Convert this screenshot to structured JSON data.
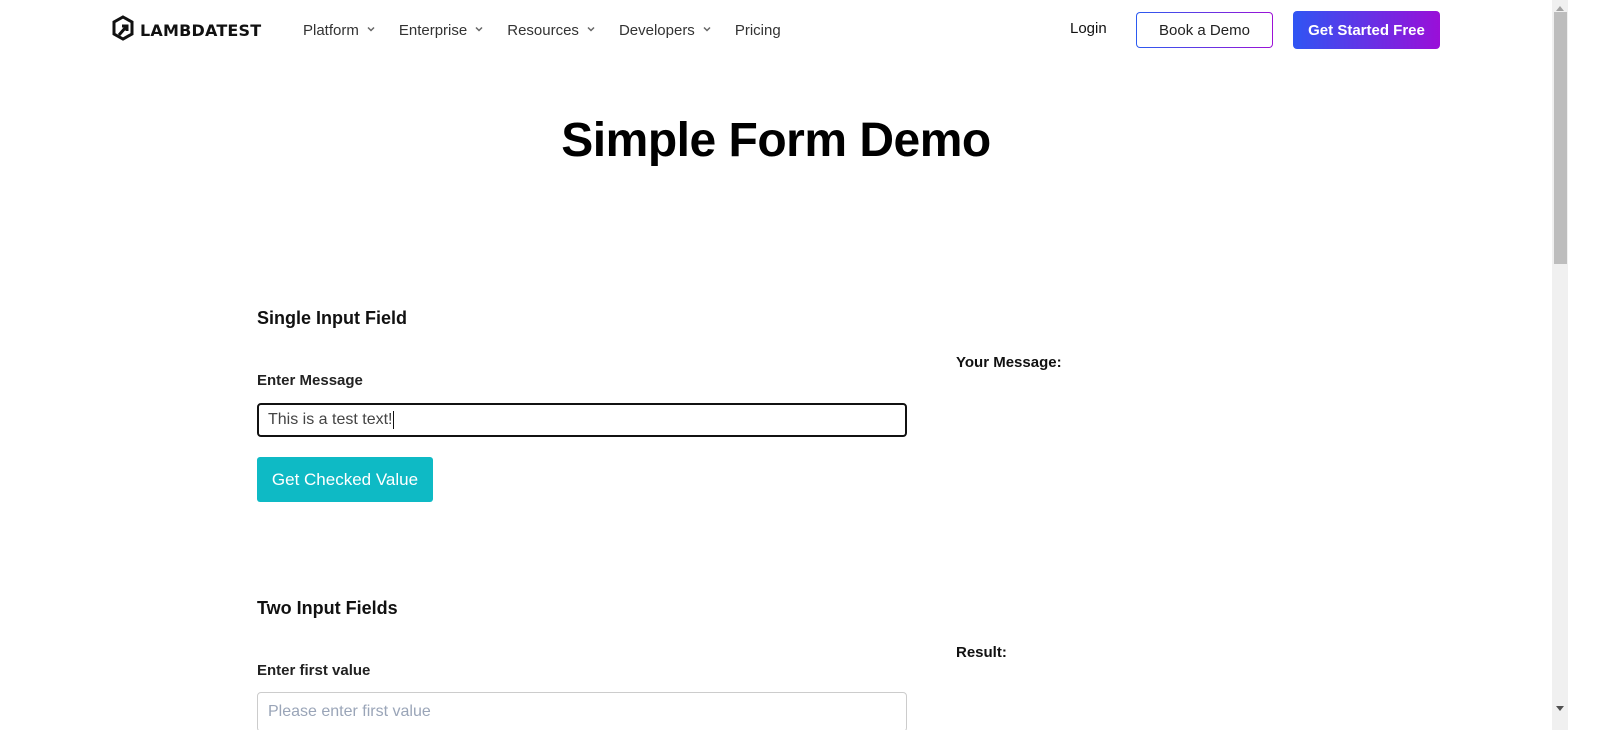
{
  "header": {
    "logo_text": "LAMBDATEST",
    "nav": [
      {
        "label": "Platform",
        "has_dropdown": true
      },
      {
        "label": "Enterprise",
        "has_dropdown": true
      },
      {
        "label": "Resources",
        "has_dropdown": true
      },
      {
        "label": "Developers",
        "has_dropdown": true
      },
      {
        "label": "Pricing",
        "has_dropdown": false
      }
    ],
    "login_label": "Login",
    "book_demo_label": "Book a Demo",
    "get_started_label": "Get Started Free"
  },
  "page": {
    "title": "Simple Form Demo"
  },
  "single_input": {
    "section_title": "Single Input Field",
    "field_label": "Enter Message",
    "input_value": "This is a test text!",
    "button_label": "Get Checked Value",
    "output_label": "Your Message:"
  },
  "two_inputs": {
    "section_title": "Two Input Fields",
    "first_label": "Enter first value",
    "first_placeholder": "Please enter first value",
    "result_label": "Result:"
  },
  "colors": {
    "accent_teal": "#0ebac5",
    "gradient_start": "#2f55f3",
    "gradient_end": "#9a0fd8"
  }
}
